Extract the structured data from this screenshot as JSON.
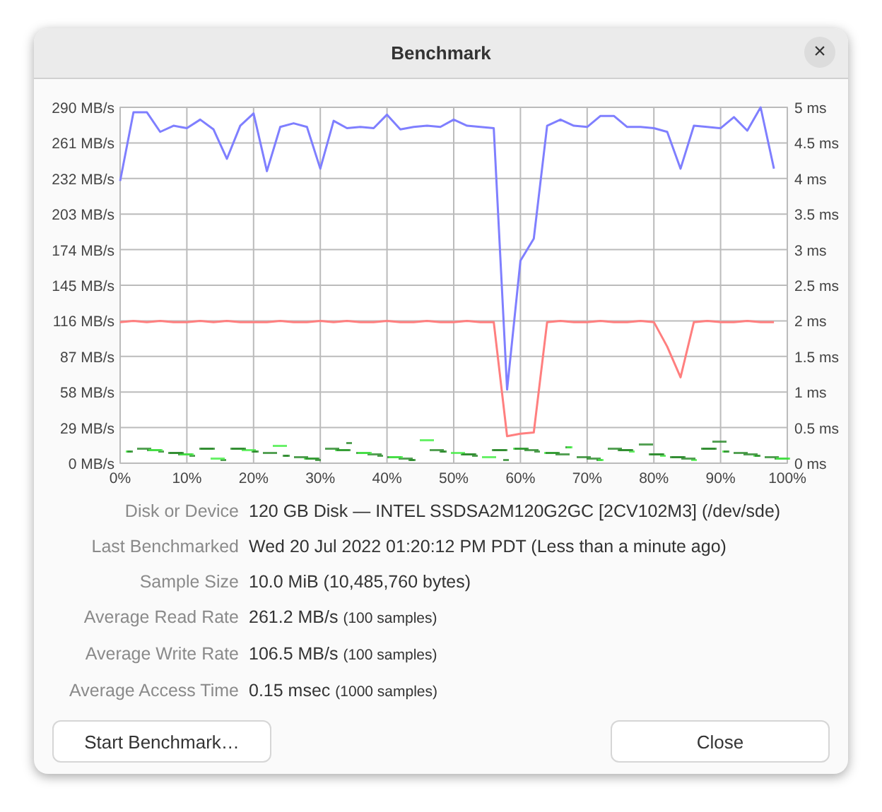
{
  "window": {
    "title": "Benchmark",
    "close": "×"
  },
  "chart": {
    "chart_data": {
      "type": "line",
      "x": [
        0,
        2,
        4,
        6,
        8,
        10,
        12,
        14,
        16,
        18,
        20,
        22,
        24,
        26,
        28,
        30,
        32,
        34,
        36,
        38,
        40,
        42,
        44,
        46,
        48,
        50,
        52,
        54,
        56,
        58,
        60,
        62,
        64,
        66,
        68,
        70,
        72,
        74,
        76,
        78,
        80,
        82,
        84,
        86,
        88,
        90,
        92,
        94,
        96,
        98
      ],
      "xlim": [
        0,
        100
      ],
      "ylim": [
        0,
        290
      ],
      "grid": true,
      "xticks": [
        {
          "value": 0,
          "label": "0%"
        },
        {
          "value": 10,
          "label": "10%"
        },
        {
          "value": 20,
          "label": "20%"
        },
        {
          "value": 30,
          "label": "30%"
        },
        {
          "value": 40,
          "label": "40%"
        },
        {
          "value": 50,
          "label": "50%"
        },
        {
          "value": 60,
          "label": "60%"
        },
        {
          "value": 70,
          "label": "70%"
        },
        {
          "value": 80,
          "label": "80%"
        },
        {
          "value": 90,
          "label": "90%"
        },
        {
          "value": 100,
          "label": "100%"
        }
      ],
      "yticks": [
        {
          "value": 0,
          "label": "0 MB/s"
        },
        {
          "value": 29,
          "label": "29 MB/s"
        },
        {
          "value": 58,
          "label": "58 MB/s"
        },
        {
          "value": 87,
          "label": "87 MB/s"
        },
        {
          "value": 116,
          "label": "116 MB/s"
        },
        {
          "value": 145,
          "label": "145 MB/s"
        },
        {
          "value": 174,
          "label": "174 MB/s"
        },
        {
          "value": 203,
          "label": "203 MB/s"
        },
        {
          "value": 232,
          "label": "232 MB/s"
        },
        {
          "value": 261,
          "label": "261 MB/s"
        },
        {
          "value": 290,
          "label": "290 MB/s"
        }
      ],
      "series": [
        {
          "color": "#7f7fff",
          "values": [
            230,
            286,
            286,
            270,
            275,
            273,
            280,
            272,
            248,
            275,
            285,
            238,
            274,
            277,
            274,
            240,
            279,
            273,
            274,
            273,
            284,
            272,
            274,
            275,
            274,
            280,
            275,
            274,
            273,
            60,
            165,
            183,
            275,
            280,
            275,
            274,
            283,
            283,
            274,
            274,
            273,
            270,
            240,
            275,
            274,
            273,
            282,
            271,
            290,
            240
          ]
        },
        {
          "color": "#ff7f7f",
          "values": [
            115,
            116,
            115,
            116,
            115,
            115,
            116,
            115,
            116,
            115,
            115,
            115,
            116,
            115,
            115,
            116,
            115,
            116,
            115,
            115,
            116,
            115,
            115,
            116,
            115,
            115,
            116,
            115,
            115,
            22,
            24,
            25,
            115,
            116,
            115,
            115,
            116,
            115,
            115,
            116,
            115,
            95,
            70,
            115,
            116,
            115,
            115,
            116,
            115,
            115
          ]
        }
      ]
    },
    "right_axis_labels": [
      "5 ms",
      "4.5 ms",
      "4 ms",
      "3.5 ms",
      "3 ms",
      "2.5 ms",
      "2 ms",
      "1.5 ms",
      "1 ms",
      "0.5 ms",
      "0 ms"
    ]
  },
  "info": [
    {
      "label": "Disk or Device",
      "value": "120 GB Disk — INTEL SSDSA2M120G2GC [2CV102M3] (/dev/sde)"
    },
    {
      "label": "Last Benchmarked",
      "value": "Wed 20 Jul 2022 01:20:12 PM PDT (Less than a minute ago)"
    },
    {
      "label": "Sample Size",
      "value": "10.0 MiB (10,485,760 bytes)"
    },
    {
      "label": "Average Read Rate",
      "value": "261.2 MB/s",
      "note": "(100 samples)"
    },
    {
      "label": "Average Write Rate",
      "value": "106.5 MB/s",
      "note": "(100 samples)"
    },
    {
      "label": "Average Access Time",
      "value": "0.15 msec",
      "note": "(1000 samples)"
    }
  ],
  "buttons": [
    "Start Benchmark…",
    "Close"
  ]
}
